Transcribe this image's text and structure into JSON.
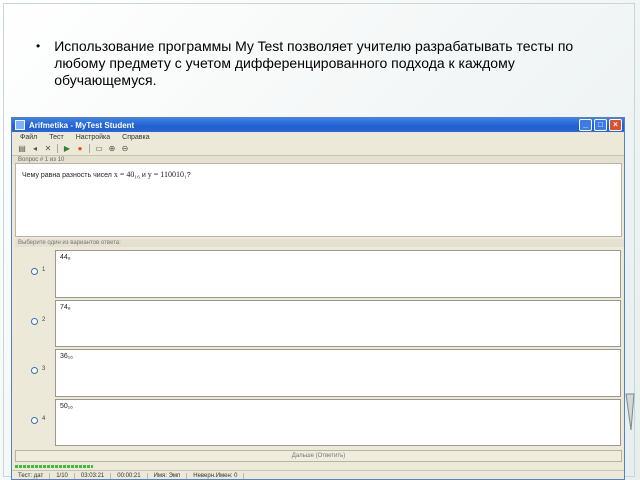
{
  "slide": {
    "bullet_text": "Использование программы My Test позволяет учителю разрабатывать тесты по любому предмету  с учетом дифференцированного подхода к каждому обучающемуся."
  },
  "window": {
    "title": "Arifmetika - MyTest Student",
    "menu": [
      "Файл",
      "Тест",
      "Настройка",
      "Справка"
    ],
    "toolbar_icons": [
      "open-icon",
      "back-icon",
      "close-test-icon",
      "play-icon",
      "stop-icon",
      "comment-icon",
      "zoom-in-icon",
      "zoom-out-icon"
    ],
    "question_header": "Вопрос # 1 из 10",
    "question_text": "Чему равна разность чисел",
    "question_formula_a": "x = 40₁₆",
    "question_conj": "и",
    "question_formula_b": "y = 110010₁",
    "question_end": "?",
    "answers_header": "Выберите один из вариантов ответа:",
    "answers": [
      {
        "num": "1",
        "text": "44₈"
      },
      {
        "num": "2",
        "text": "74₈"
      },
      {
        "num": "3",
        "text": "36₁₆"
      },
      {
        "num": "4",
        "text": "50₁₆"
      }
    ],
    "next_button": "Дальше (Ответить)",
    "status": [
      "Тест: дат",
      "1/10",
      "03:03:21",
      "00:00:21",
      "Имя: Эмп",
      "Неверн.Имен: 0"
    ]
  },
  "colors": {
    "titlebar": "#1f5fd0",
    "window_bg": "#ece9d8",
    "progress": "#3fbf3f"
  }
}
